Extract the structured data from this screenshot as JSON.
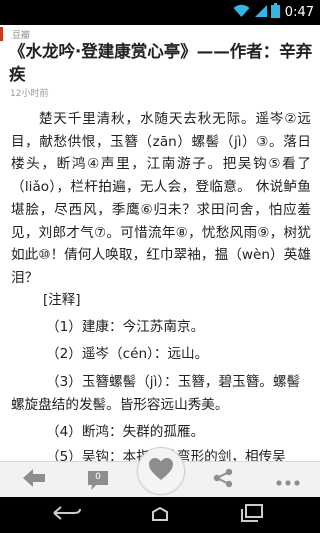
{
  "status_bar": {
    "time": "0:47"
  },
  "header": {
    "app_name": "豆瓣"
  },
  "article": {
    "title": "《水龙吟·登建康赏心亭》——作者：辛弃疾",
    "timestamp": "12小时前",
    "poem": "楚天千里清秋，水随天去秋无际。遥岑②远目，献愁供恨，玉簪（zān）螺髻（jì）③。落日楼头，断鸿④声里，江南游子。把吴钩⑤看了（liǎo），栏杆拍遍，无人会，登临意。 休说鲈鱼堪脍，尽西风，季鹰⑥归未？求田问舍，怕应羞见，刘郎才气⑦。可惜流年⑧，忧愁风雨⑨，树犹如此⑩！倩何人唤取，红巾翠袖，揾（wèn）英雄泪？",
    "notes_heading": "[注释]",
    "notes": [
      "（1）建康：今江苏南京。",
      "（2）遥岑（cén）：远山。",
      "（3）玉簪螺髻（jì）：玉簪，碧玉簪。螺髻螺旋盘结的发髻。皆形容远山秀美。",
      "（4）断鸿：失群的孤雁。",
      "（5）吴钩：本指一种弯形的剑，相传吴"
    ]
  },
  "bottom_bar": {
    "comment_count": "0"
  },
  "colors": {
    "accent": "#c23b22",
    "status_bar": "#000000",
    "toolbar": "#f2f2f2",
    "icon_grey": "#8e8e8e"
  },
  "icons": [
    "wifi-icon",
    "signal-icon",
    "battery-icon",
    "back-arrow-icon",
    "comment-icon",
    "heart-icon",
    "share-icon",
    "more-icon",
    "nav-back-icon",
    "nav-home-icon",
    "nav-recents-icon"
  ]
}
